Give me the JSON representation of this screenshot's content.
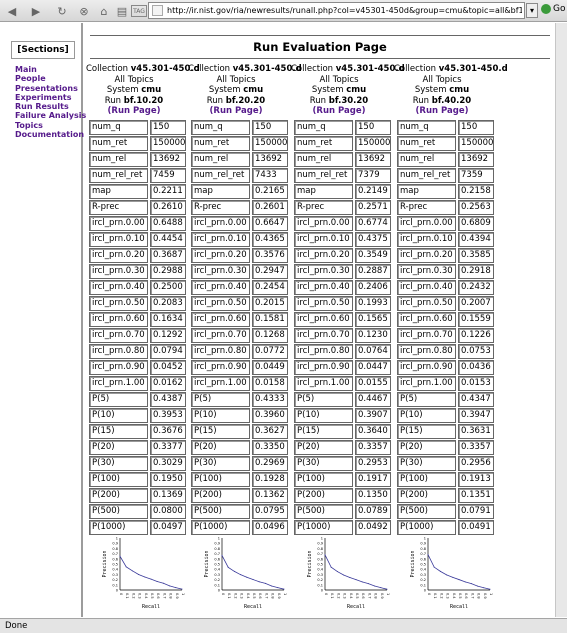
{
  "browser": {
    "url": "http://ir.nist.gov/ria/newresults/runall.php?col=v45301-450d&group=cmu&topic=all&bf1020=1&",
    "go_label": "Go",
    "status": "Done"
  },
  "sidebar": {
    "heading": "[Sections]",
    "items": [
      "Main",
      "People",
      "Presentations",
      "Experiments",
      "Run Results",
      "Failure Analysis",
      "Topics",
      "Documentation"
    ]
  },
  "page": {
    "title": "Run Evaluation Page"
  },
  "columns": [
    {
      "collection_label": "Collection",
      "collection": "v45.301-450.d",
      "topics": "All Topics",
      "system_label": "System",
      "system": "cmu",
      "run_label": "Run",
      "run": "bf.10.20",
      "run_page_link": "(Run Page)",
      "metrics": [
        [
          "num_q",
          "150"
        ],
        [
          "num_ret",
          "150000"
        ],
        [
          "num_rel",
          "13692"
        ],
        [
          "num_rel_ret",
          "7459"
        ],
        [
          "map",
          "0.2211"
        ],
        [
          "R-prec",
          "0.2610"
        ],
        [
          "ircl_prn.0.00",
          "0.6488"
        ],
        [
          "ircl_prn.0.10",
          "0.4454"
        ],
        [
          "ircl_prn.0.20",
          "0.3687"
        ],
        [
          "ircl_prn.0.30",
          "0.2988"
        ],
        [
          "ircl_prn.0.40",
          "0.2500"
        ],
        [
          "ircl_prn.0.50",
          "0.2083"
        ],
        [
          "ircl_prn.0.60",
          "0.1634"
        ],
        [
          "ircl_prn.0.70",
          "0.1292"
        ],
        [
          "ircl_prn.0.80",
          "0.0794"
        ],
        [
          "ircl_prn.0.90",
          "0.0452"
        ],
        [
          "ircl_prn.1.00",
          "0.0162"
        ],
        [
          "P(5)",
          "0.4387"
        ],
        [
          "P(10)",
          "0.3953"
        ],
        [
          "P(15)",
          "0.3676"
        ],
        [
          "P(20)",
          "0.3377"
        ],
        [
          "P(30)",
          "0.3029"
        ],
        [
          "P(100)",
          "0.1950"
        ],
        [
          "P(200)",
          "0.1369"
        ],
        [
          "P(500)",
          "0.0800"
        ],
        [
          "P(1000)",
          "0.0497"
        ]
      ]
    },
    {
      "collection_label": "Collection",
      "collection": "v45.301-450.d",
      "topics": "All Topics",
      "system_label": "System",
      "system": "cmu",
      "run_label": "Run",
      "run": "bf.20.20",
      "run_page_link": "(Run Page)",
      "metrics": [
        [
          "num_q",
          "150"
        ],
        [
          "num_ret",
          "150000"
        ],
        [
          "num_rel",
          "13692"
        ],
        [
          "num_rel_ret",
          "7433"
        ],
        [
          "map",
          "0.2165"
        ],
        [
          "R-prec",
          "0.2601"
        ],
        [
          "ircl_prn.0.00",
          "0.6647"
        ],
        [
          "ircl_prn.0.10",
          "0.4365"
        ],
        [
          "ircl_prn.0.20",
          "0.3576"
        ],
        [
          "ircl_prn.0.30",
          "0.2947"
        ],
        [
          "ircl_prn.0.40",
          "0.2454"
        ],
        [
          "ircl_prn.0.50",
          "0.2015"
        ],
        [
          "ircl_prn.0.60",
          "0.1581"
        ],
        [
          "ircl_prn.0.70",
          "0.1268"
        ],
        [
          "ircl_prn.0.80",
          "0.0772"
        ],
        [
          "ircl_prn.0.90",
          "0.0449"
        ],
        [
          "ircl_prn.1.00",
          "0.0158"
        ],
        [
          "P(5)",
          "0.4333"
        ],
        [
          "P(10)",
          "0.3960"
        ],
        [
          "P(15)",
          "0.3627"
        ],
        [
          "P(20)",
          "0.3350"
        ],
        [
          "P(30)",
          "0.2969"
        ],
        [
          "P(100)",
          "0.1928"
        ],
        [
          "P(200)",
          "0.1362"
        ],
        [
          "P(500)",
          "0.0795"
        ],
        [
          "P(1000)",
          "0.0496"
        ]
      ]
    },
    {
      "collection_label": "Collection",
      "collection": "v45.301-450.d",
      "topics": "All Topics",
      "system_label": "System",
      "system": "cmu",
      "run_label": "Run",
      "run": "bf.30.20",
      "run_page_link": "(Run Page)",
      "metrics": [
        [
          "num_q",
          "150"
        ],
        [
          "num_ret",
          "150000"
        ],
        [
          "num_rel",
          "13692"
        ],
        [
          "num_rel_ret",
          "7379"
        ],
        [
          "map",
          "0.2149"
        ],
        [
          "R-prec",
          "0.2571"
        ],
        [
          "ircl_prn.0.00",
          "0.6774"
        ],
        [
          "ircl_prn.0.10",
          "0.4375"
        ],
        [
          "ircl_prn.0.20",
          "0.3549"
        ],
        [
          "ircl_prn.0.30",
          "0.2887"
        ],
        [
          "ircl_prn.0.40",
          "0.2406"
        ],
        [
          "ircl_prn.0.50",
          "0.1993"
        ],
        [
          "ircl_prn.0.60",
          "0.1565"
        ],
        [
          "ircl_prn.0.70",
          "0.1230"
        ],
        [
          "ircl_prn.0.80",
          "0.0764"
        ],
        [
          "ircl_prn.0.90",
          "0.0447"
        ],
        [
          "ircl_prn.1.00",
          "0.0155"
        ],
        [
          "P(5)",
          "0.4467"
        ],
        [
          "P(10)",
          "0.3907"
        ],
        [
          "P(15)",
          "0.3640"
        ],
        [
          "P(20)",
          "0.3357"
        ],
        [
          "P(30)",
          "0.2953"
        ],
        [
          "P(100)",
          "0.1917"
        ],
        [
          "P(200)",
          "0.1350"
        ],
        [
          "P(500)",
          "0.0789"
        ],
        [
          "P(1000)",
          "0.0492"
        ]
      ]
    },
    {
      "collection_label": "Collection",
      "collection": "v45.301-450.d",
      "topics": "All Topics",
      "system_label": "System",
      "system": "cmu",
      "run_label": "Run",
      "run": "bf.40.20",
      "run_page_link": "(Run Page)",
      "metrics": [
        [
          "num_q",
          "150"
        ],
        [
          "num_ret",
          "150000"
        ],
        [
          "num_rel",
          "13692"
        ],
        [
          "num_rel_ret",
          "7359"
        ],
        [
          "map",
          "0.2158"
        ],
        [
          "R-prec",
          "0.2563"
        ],
        [
          "ircl_prn.0.00",
          "0.6809"
        ],
        [
          "ircl_prn.0.10",
          "0.4394"
        ],
        [
          "ircl_prn.0.20",
          "0.3585"
        ],
        [
          "ircl_prn.0.30",
          "0.2918"
        ],
        [
          "ircl_prn.0.40",
          "0.2432"
        ],
        [
          "ircl_prn.0.50",
          "0.2007"
        ],
        [
          "ircl_prn.0.60",
          "0.1559"
        ],
        [
          "ircl_prn.0.70",
          "0.1226"
        ],
        [
          "ircl_prn.0.80",
          "0.0753"
        ],
        [
          "ircl_prn.0.90",
          "0.0436"
        ],
        [
          "ircl_prn.1.00",
          "0.0153"
        ],
        [
          "P(5)",
          "0.4347"
        ],
        [
          "P(10)",
          "0.3947"
        ],
        [
          "P(15)",
          "0.3631"
        ],
        [
          "P(20)",
          "0.3357"
        ],
        [
          "P(30)",
          "0.2956"
        ],
        [
          "P(100)",
          "0.1913"
        ],
        [
          "P(200)",
          "0.1351"
        ],
        [
          "P(500)",
          "0.0791"
        ],
        [
          "P(1000)",
          "0.0491"
        ]
      ]
    }
  ],
  "chart_data": [
    {
      "type": "line",
      "xlabel": "Recall",
      "ylabel": "Precision",
      "xlim": [
        0,
        1
      ],
      "ylim": [
        0,
        1
      ],
      "x": [
        0,
        0.1,
        0.2,
        0.3,
        0.4,
        0.5,
        0.6,
        0.7,
        0.8,
        0.9,
        1.0
      ],
      "series": [
        {
          "values": [
            0.6488,
            0.4454,
            0.3687,
            0.2988,
            0.25,
            0.2083,
            0.1634,
            0.1292,
            0.0794,
            0.0452,
            0.0162
          ]
        }
      ]
    },
    {
      "type": "line",
      "xlabel": "Recall",
      "ylabel": "Precision",
      "xlim": [
        0,
        1
      ],
      "ylim": [
        0,
        1
      ],
      "x": [
        0,
        0.1,
        0.2,
        0.3,
        0.4,
        0.5,
        0.6,
        0.7,
        0.8,
        0.9,
        1.0
      ],
      "series": [
        {
          "values": [
            0.6647,
            0.4365,
            0.3576,
            0.2947,
            0.2454,
            0.2015,
            0.1581,
            0.1268,
            0.0772,
            0.0449,
            0.0158
          ]
        }
      ]
    },
    {
      "type": "line",
      "xlabel": "Recall",
      "ylabel": "Precision",
      "xlim": [
        0,
        1
      ],
      "ylim": [
        0,
        1
      ],
      "x": [
        0,
        0.1,
        0.2,
        0.3,
        0.4,
        0.5,
        0.6,
        0.7,
        0.8,
        0.9,
        1.0
      ],
      "series": [
        {
          "values": [
            0.6774,
            0.4375,
            0.3549,
            0.2887,
            0.2406,
            0.1993,
            0.1565,
            0.123,
            0.0764,
            0.0447,
            0.0155
          ]
        }
      ]
    },
    {
      "type": "line",
      "xlabel": "Recall",
      "ylabel": "Precision",
      "xlim": [
        0,
        1
      ],
      "ylim": [
        0,
        1
      ],
      "x": [
        0,
        0.1,
        0.2,
        0.3,
        0.4,
        0.5,
        0.6,
        0.7,
        0.8,
        0.9,
        1.0
      ],
      "series": [
        {
          "values": [
            0.6809,
            0.4394,
            0.3585,
            0.2918,
            0.2432,
            0.2007,
            0.1559,
            0.1226,
            0.0753,
            0.0436,
            0.0153
          ]
        }
      ]
    }
  ],
  "icons": [
    "back-icon",
    "forward-icon",
    "reload-icon",
    "stop-icon",
    "home-icon",
    "print-icon",
    "tag-icon",
    "site-icon",
    "go-icon"
  ]
}
